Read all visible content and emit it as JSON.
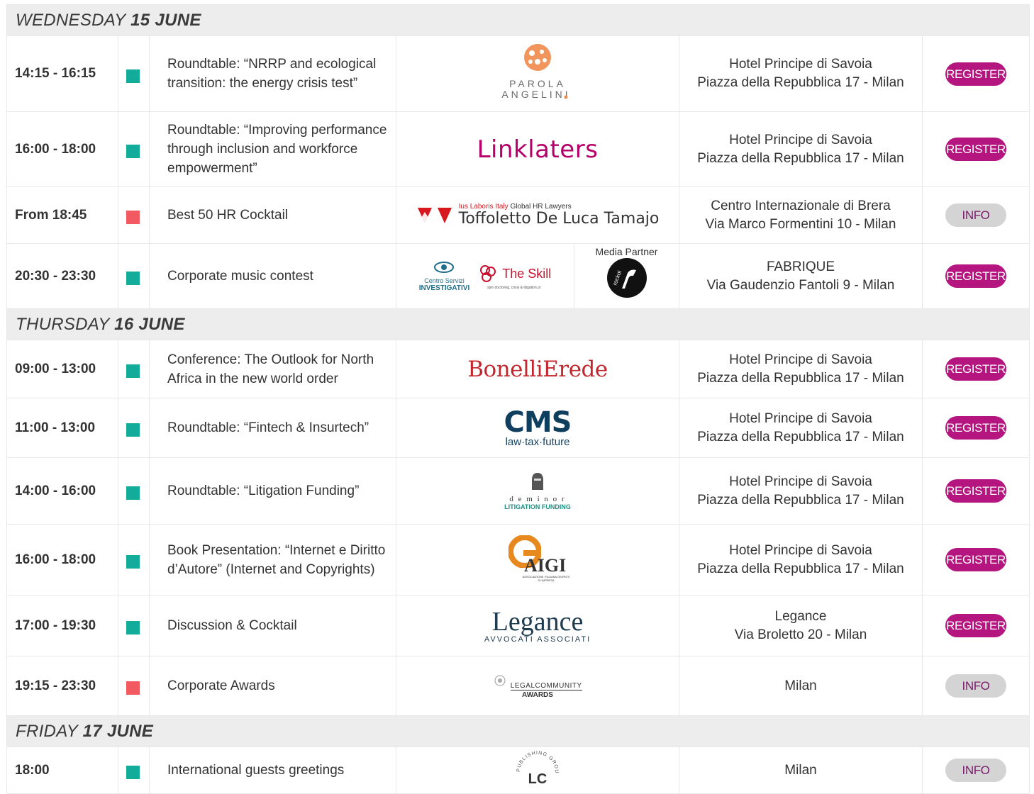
{
  "days": [
    {
      "weekday": "WEDNESDAY",
      "date": "15 JUNE"
    },
    {
      "weekday": "THURSDAY",
      "date": "16 JUNE"
    },
    {
      "weekday": "FRIDAY",
      "date": "17 JUNE"
    }
  ],
  "colors": {
    "green": "#13ab9a",
    "red": "#f15a60",
    "register": "#b4157f",
    "info": "#d4d4d4"
  },
  "events": [
    {
      "time": "14:15 - 16:15",
      "marker": "green",
      "title": "Roundtable: “NRRP and ecological transition: the energy crisis test”",
      "logo": "parola-angelini-logo",
      "logo_text": [
        "PAROLA",
        "ANGELINI"
      ],
      "venue": [
        "Hotel Principe di Savoia",
        "Piazza della Repubblica 17 - Milan"
      ],
      "button": "REGISTER"
    },
    {
      "time": "16:00 - 18:00",
      "marker": "green",
      "title": "Roundtable: “Improving performance through inclusion and workforce empowerment”",
      "logo": "linklaters-logo",
      "logo_text": [
        "Linklaters"
      ],
      "venue": [
        "Hotel Principe di Savoia",
        "Piazza della Repubblica 17 - Milan"
      ],
      "button": "REGISTER"
    },
    {
      "time": "From 18:45",
      "marker": "red",
      "title": "Best 50 HR Cocktail",
      "logo": "toffoletto-logo",
      "logo_text": [
        "Ius Laboris Italy",
        "Global HR Lawyers",
        "Toffoletto De Luca Tamajo"
      ],
      "venue": [
        "Centro Internazionale di Brera",
        "Via Marco Formentini 10 - Milan"
      ],
      "button": "INFO"
    },
    {
      "time": "20:30 - 23:30",
      "marker": "green",
      "title": "Corporate music contest",
      "logo": "music-contest-logos",
      "logo_text": [
        "Centro Servizi",
        "INVESTIGATIVI",
        "The Skill",
        "spin doctoring, crisis & litigation pr",
        "Media Partner",
        "rockol"
      ],
      "venue": [
        "FABRIQUE",
        "Via Gaudenzio Fantoli 9 - Milan"
      ],
      "button": "REGISTER"
    },
    {
      "time": "09:00 - 13:00",
      "marker": "green",
      "title": "Conference: The Outlook for North Africa in the new world order",
      "logo": "bonellierede-logo",
      "logo_text": [
        "BonelliErede"
      ],
      "venue": [
        "Hotel Principe di Savoia",
        "Piazza della Repubblica 17 - Milan"
      ],
      "button": "REGISTER"
    },
    {
      "time": "11:00 - 13:00",
      "marker": "green",
      "title": "Roundtable: “Fintech & Insurtech”",
      "logo": "cms-logo",
      "logo_text": [
        "CMS",
        "law·tax·future"
      ],
      "venue": [
        "Hotel Principe di Savoia",
        "Piazza della Repubblica 17 - Milan"
      ],
      "button": "REGISTER"
    },
    {
      "time": "14:00 - 16:00",
      "marker": "green",
      "title": "Roundtable: “Litigation Funding”",
      "logo": "deminor-logo",
      "logo_text": [
        "d e m i n o r",
        "LITIGATION FUNDING"
      ],
      "venue": [
        "Hotel Principe di Savoia",
        "Piazza della Repubblica 17 - Milan"
      ],
      "button": "REGISTER"
    },
    {
      "time": "16:00 - 18:00",
      "marker": "green",
      "title": "Book Presentation: “Internet e Diritto d’Autore” (Internet and Copyrights)",
      "logo": "aigi-logo",
      "logo_text": [
        "AIGI",
        "ASSOCIAZIONE ITALIANA GIURISTI DI IMPRESA"
      ],
      "venue": [
        "Hotel Principe di Savoia",
        "Piazza della Repubblica 17 - Milan"
      ],
      "button": "REGISTER"
    },
    {
      "time": "17:00 - 19:30",
      "marker": "green",
      "title": "Discussion & Cocktail",
      "logo": "legance-logo",
      "logo_text": [
        "Legance",
        "AVVOCATI ASSOCIATI"
      ],
      "venue": [
        "Legance",
        "Via Broletto 20 - Milan"
      ],
      "button": "REGISTER"
    },
    {
      "time": "19:15 - 23:30",
      "marker": "red",
      "title": "Corporate Awards",
      "logo": "legalcommunity-awards-logo",
      "logo_text": [
        "LEGALCOMMUNITY",
        "AWARDS"
      ],
      "venue": [
        "Milan"
      ],
      "button": "INFO"
    },
    {
      "time": "18:00",
      "marker": "green",
      "title": "International guests greetings",
      "logo": "lc-publishing-logo",
      "logo_text": [
        "PUBLISHING GROUP",
        "LC"
      ],
      "venue": [
        "Milan"
      ],
      "button": "INFO"
    }
  ]
}
